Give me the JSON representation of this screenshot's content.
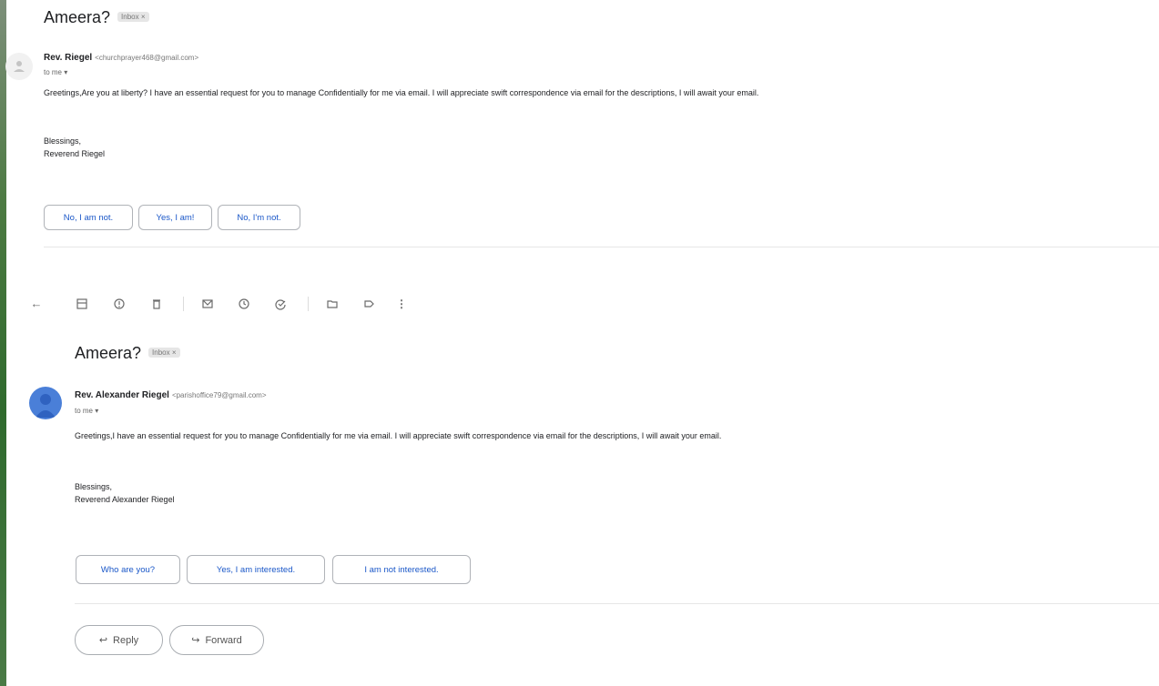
{
  "email1": {
    "subject": "Ameera?",
    "badge": "Inbox ×",
    "sender_name": "Rev. Riegel",
    "sender_email": "<churchprayer468@gmail.com>",
    "to_me": "to me ▾",
    "body": "Greetings,Are you at liberty? I have an essential request for you to manage Confidentially for me via email. I will appreciate swift correspondence via email for the descriptions, I will await your email.",
    "sig1": "Blessings,",
    "sig2": "Reverend Riegel",
    "replies": [
      "No, I am not.",
      "Yes, I am!",
      "No, I'm not."
    ]
  },
  "email2": {
    "subject": "Ameera?",
    "badge": "Inbox ×",
    "sender_name": "Rev. Alexander Riegel",
    "sender_email": "<parishoffice79@gmail.com>",
    "to_me": "to me ▾",
    "body": "Greetings,I have an essential request for you to manage Confidentially for me via email. I will appreciate swift correspondence via email for the descriptions, I will await your email.",
    "sig1": "Blessings,",
    "sig2": "Reverend  Alexander Riegel",
    "replies": [
      "Who are you?",
      "Yes, I am interested.",
      "I am not interested."
    ]
  },
  "actions": {
    "reply": "Reply",
    "forward": "Forward"
  },
  "colors": {
    "link_blue": "#1a57c8",
    "avatar_blue": "#4a7fd8"
  }
}
